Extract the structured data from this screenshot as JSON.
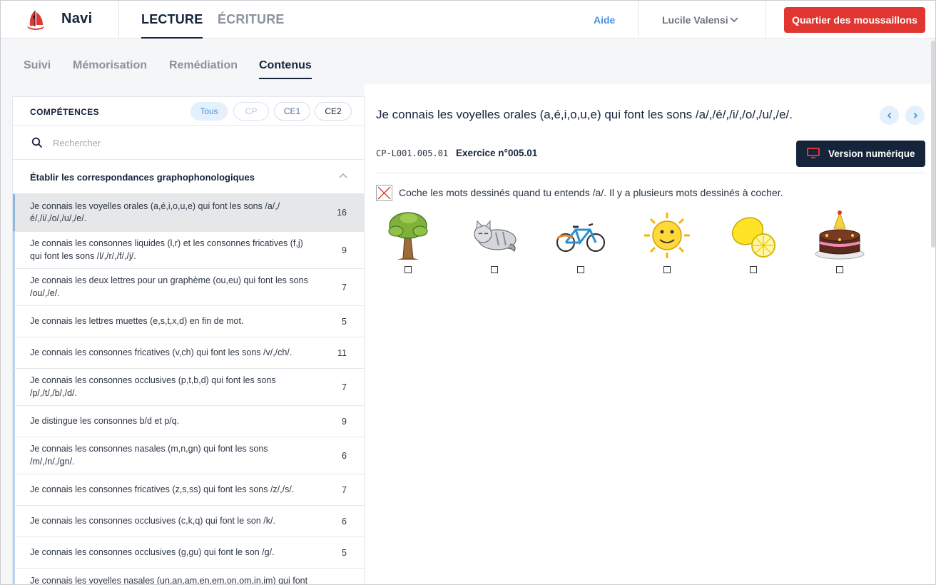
{
  "app": {
    "brand": "Navi",
    "tabs": [
      "LECTURE",
      "ÉCRITURE"
    ],
    "help": "Aide",
    "user": "Lucile Valensi",
    "cta": "Quartier des moussaillons"
  },
  "subnav": [
    "Suivi",
    "Mémorisation",
    "Remédiation",
    "Contenus"
  ],
  "competences": {
    "title": "COMPÉTENCES",
    "filters": [
      "Tous",
      "CP",
      "CE1",
      "CE2"
    ],
    "search_placeholder": "Rechercher",
    "group_title": "Établir les correspondances graphophonologiques",
    "items": [
      {
        "text": "Je connais les voyelles orales (a,é,i,o,u,e) qui font les sons /a/,/é/,/i/,/o/,/u/,/e/.",
        "count": "16"
      },
      {
        "text": "Je connais les consonnes liquides (l,r) et les consonnes fricatives (f,j) qui font les sons /l/,/r/,/f/,/j/.",
        "count": "9"
      },
      {
        "text": "Je connais les deux lettres pour un graphème (ou,eu) qui font les sons /ou/,/e/.",
        "count": "7"
      },
      {
        "text": "Je connais les lettres muettes (e,s,t,x,d) en fin de mot.",
        "count": "5"
      },
      {
        "text": "Je connais les consonnes fricatives (v,ch) qui font les sons /v/,/ch/.",
        "count": "11"
      },
      {
        "text": "Je connais les consonnes occlusives (p,t,b,d) qui font les sons /p/,/t/,/b/,/d/.",
        "count": "7"
      },
      {
        "text": "Je distingue les consonnes b/d et p/q.",
        "count": "9"
      },
      {
        "text": "Je connais les consonnes nasales (m,n,gn) qui font les sons /m/,/n/,/gn/.",
        "count": "6"
      },
      {
        "text": "Je connais les consonnes fricatives (z,s,ss) qui font les sons /z/,/s/.",
        "count": "7"
      },
      {
        "text": "Je connais les consonnes occlusives (c,k,q) qui font le son /k/.",
        "count": "6"
      },
      {
        "text": "Je connais les consonnes occlusives (g,gu) qui font le son /g/.",
        "count": "5"
      },
      {
        "text": "Je connais les voyelles nasales (un,an,am,en,em,on,om,in,im) qui font",
        "count": ""
      }
    ]
  },
  "exercise": {
    "title": "Je connais les voyelles orales (a,é,i,o,u,e) qui font les sons /a/,/é/,/i/,/o/,/u/,/e/.",
    "code": "CP-L001.005.01",
    "number": "Exercice n°005.01",
    "digital_button": "Version numérique",
    "instruction": "Coche les mots dessinés quand tu entends /a/. Il y a plusieurs mots dessinés à cocher.",
    "pictures": [
      "tree-image",
      "cat-image",
      "bicycle-image",
      "sun-image",
      "lemon-image",
      "cake-image"
    ]
  },
  "colors": {
    "navy": "#15243b",
    "accent_blue": "#4a90e2",
    "cta_red": "#e0362f"
  }
}
